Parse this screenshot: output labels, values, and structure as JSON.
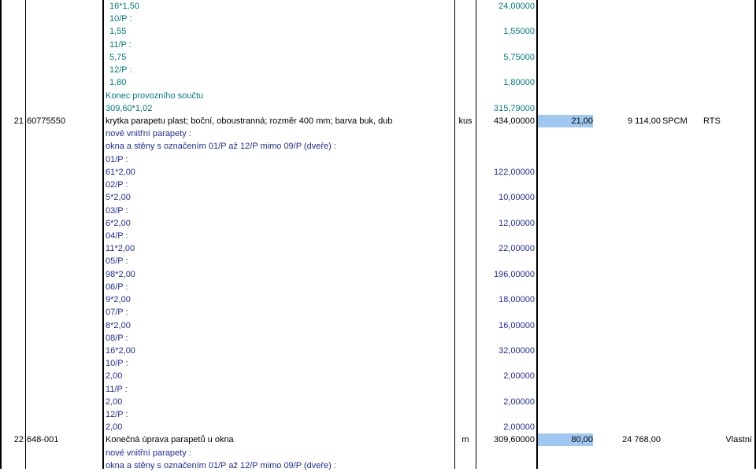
{
  "colors": {
    "teal_text": "#007a7a",
    "blue_text": "#1f2d99",
    "highlight": "#9fc7ef"
  },
  "rows": [
    {
      "type": "m",
      "color": "teal",
      "label": "16*1,50",
      "value": "24,00000"
    },
    {
      "type": "m",
      "color": "teal",
      "label": "10/P :",
      "value": ""
    },
    {
      "type": "m",
      "color": "teal",
      "label": "1,55",
      "value": "1,55000"
    },
    {
      "type": "m",
      "color": "teal",
      "label": "11/P :",
      "value": ""
    },
    {
      "type": "m",
      "color": "teal",
      "label": "5,75",
      "value": "5,75000"
    },
    {
      "type": "m",
      "color": "teal",
      "label": "12/P :",
      "value": ""
    },
    {
      "type": "m",
      "color": "teal",
      "label": "1,80",
      "value": "1,80000"
    },
    {
      "type": "d",
      "color": "teal",
      "label": "Konec provozního součtu",
      "value": ""
    },
    {
      "type": "d",
      "color": "teal",
      "label": "309,60*1,02",
      "value": "315,79000"
    },
    {
      "type": "item",
      "no": "21",
      "code": "60775550",
      "desc": "krytka parapetu plast; boční, oboustranná; rozměr 400 mm; barva buk, dub",
      "unit": "kus",
      "qty": "434,00000",
      "price": "21,00",
      "total": "9 114,00",
      "catalog": "SPCM",
      "source": "RTS"
    },
    {
      "type": "d",
      "color": "blue",
      "label": "nové vnitřní parapety :",
      "value": ""
    },
    {
      "type": "d",
      "color": "blue",
      "label": "okna a stěny s označením 01/P až 12/P mimo 09/P (dveře) :",
      "value": ""
    },
    {
      "type": "d",
      "color": "blue",
      "label": "01/P :",
      "value": ""
    },
    {
      "type": "d",
      "color": "blue",
      "label": "61*2,00",
      "value": "122,00000"
    },
    {
      "type": "d",
      "color": "blue",
      "label": "02/P :",
      "value": ""
    },
    {
      "type": "d",
      "color": "blue",
      "label": "5*2,00",
      "value": "10,00000"
    },
    {
      "type": "d",
      "color": "blue",
      "label": "03/P :",
      "value": ""
    },
    {
      "type": "d",
      "color": "blue",
      "label": "6*2,00",
      "value": "12,00000"
    },
    {
      "type": "d",
      "color": "blue",
      "label": "04/P :",
      "value": ""
    },
    {
      "type": "d",
      "color": "blue",
      "label": "11*2,00",
      "value": "22,00000"
    },
    {
      "type": "d",
      "color": "blue",
      "label": "05/P :",
      "value": ""
    },
    {
      "type": "d",
      "color": "blue",
      "label": "98*2,00",
      "value": "196,00000"
    },
    {
      "type": "d",
      "color": "blue",
      "label": "06/P :",
      "value": ""
    },
    {
      "type": "d",
      "color": "blue",
      "label": "9*2,00",
      "value": "18,00000"
    },
    {
      "type": "d",
      "color": "blue",
      "label": "07/P :",
      "value": ""
    },
    {
      "type": "d",
      "color": "blue",
      "label": "8*2,00",
      "value": "16,00000"
    },
    {
      "type": "d",
      "color": "blue",
      "label": "08/P :",
      "value": ""
    },
    {
      "type": "d",
      "color": "blue",
      "label": "16*2,00",
      "value": "32,00000"
    },
    {
      "type": "d",
      "color": "blue",
      "label": "10/P :",
      "value": ""
    },
    {
      "type": "d",
      "color": "blue",
      "label": "2,00",
      "value": "2,00000"
    },
    {
      "type": "d",
      "color": "blue",
      "label": "11/P :",
      "value": ""
    },
    {
      "type": "d",
      "color": "blue",
      "label": "2,00",
      "value": "2,00000"
    },
    {
      "type": "d",
      "color": "blue",
      "label": "12/P :",
      "value": ""
    },
    {
      "type": "d",
      "color": "blue",
      "label": "2,00",
      "value": "2,00000"
    },
    {
      "type": "item",
      "no": "22",
      "code": "648-001",
      "desc": "Konečná úprava parapetů u okna",
      "unit": "m",
      "qty": "309,60000",
      "price": "80,00",
      "total": "24 768,00",
      "catalog": "",
      "source": "Vlastní"
    },
    {
      "type": "d",
      "color": "blue",
      "label": "nové vnitřní parapety :",
      "value": ""
    },
    {
      "type": "d",
      "color": "blue",
      "label": "okna a stěny s označením 01/P až 12/P mimo 09/P (dveře) :",
      "value": ""
    }
  ]
}
